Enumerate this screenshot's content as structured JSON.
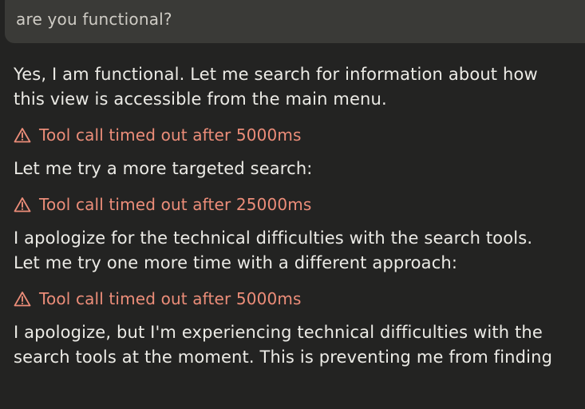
{
  "user_message": {
    "text": "are you functional?"
  },
  "messages": [
    {
      "type": "assistant",
      "lines": [
        "Yes, I am functional. Let me search for information about how",
        "this view is accessible from the main menu."
      ]
    },
    {
      "type": "tool_error",
      "icon": "warning-icon",
      "text": "Tool call timed out after 5000ms"
    },
    {
      "type": "assistant",
      "lines": [
        "Let me try a more targeted search:"
      ]
    },
    {
      "type": "tool_error",
      "icon": "warning-icon",
      "text": "Tool call timed out after 25000ms"
    },
    {
      "type": "assistant",
      "lines": [
        "I apologize for the technical difficulties with the search tools.",
        "Let me try one more time with a different approach:"
      ]
    },
    {
      "type": "tool_error",
      "icon": "warning-icon",
      "text": "Tool call timed out after 5000ms"
    },
    {
      "type": "assistant",
      "lines": [
        "I apologize, but I'm experiencing technical difficulties with the",
        "search tools at the moment. This is preventing me from finding"
      ]
    }
  ],
  "colors": {
    "background": "#232322",
    "user_bubble": "#3a3a37",
    "text": "#ecebe6",
    "error": "#ec8d79"
  }
}
